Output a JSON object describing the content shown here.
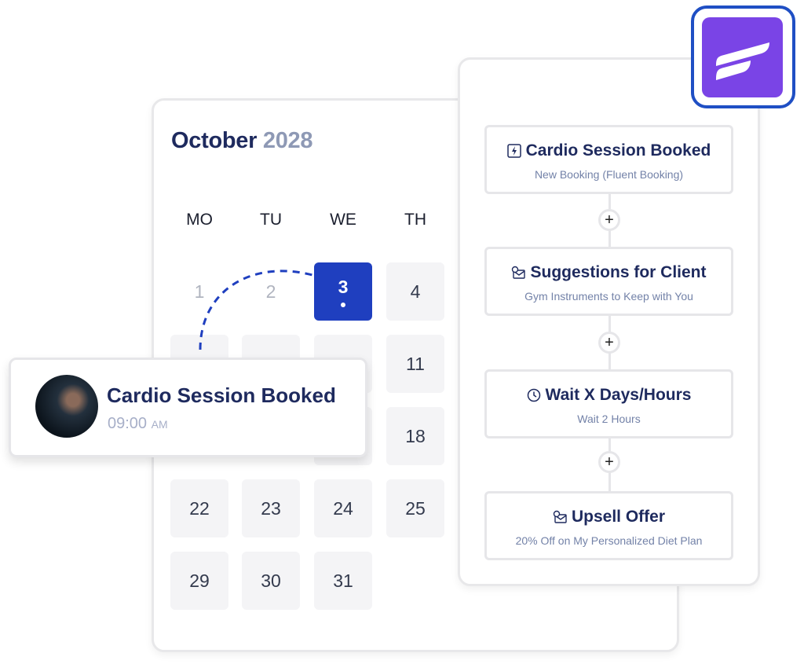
{
  "calendar": {
    "month": "October",
    "year": "2028",
    "weekdays": [
      "MO",
      "TU",
      "WE",
      "TH"
    ],
    "days": {
      "d1": "1",
      "d2": "2",
      "d3": "3",
      "d4": "4",
      "d11": "11",
      "d18": "18",
      "d22": "22",
      "d23": "23",
      "d24": "24",
      "d25": "25",
      "d29": "29",
      "d30": "30",
      "d31": "31"
    },
    "selected_day": "3",
    "accent": "#1f3fbf"
  },
  "event": {
    "title": "Cardio Session Booked",
    "time": "09:00",
    "meridiem": "AM"
  },
  "flow": {
    "nodes": [
      {
        "title": "Cardio Session Booked",
        "subtitle": "New Booking (Fluent Booking)",
        "icon": "lightning-icon"
      },
      {
        "title": "Suggestions for Client",
        "subtitle": "Gym Instruments to Keep with You",
        "icon": "email-icon"
      },
      {
        "title": "Wait X Days/Hours",
        "subtitle": "Wait 2 Hours",
        "icon": "clock-icon"
      },
      {
        "title": "Upsell Offer",
        "subtitle": "20% Off on My Personalized Diet Plan",
        "icon": "email-icon"
      }
    ],
    "add_label": "+"
  },
  "logo": {
    "color": "#7a44e6",
    "border": "#1f4fc4"
  }
}
